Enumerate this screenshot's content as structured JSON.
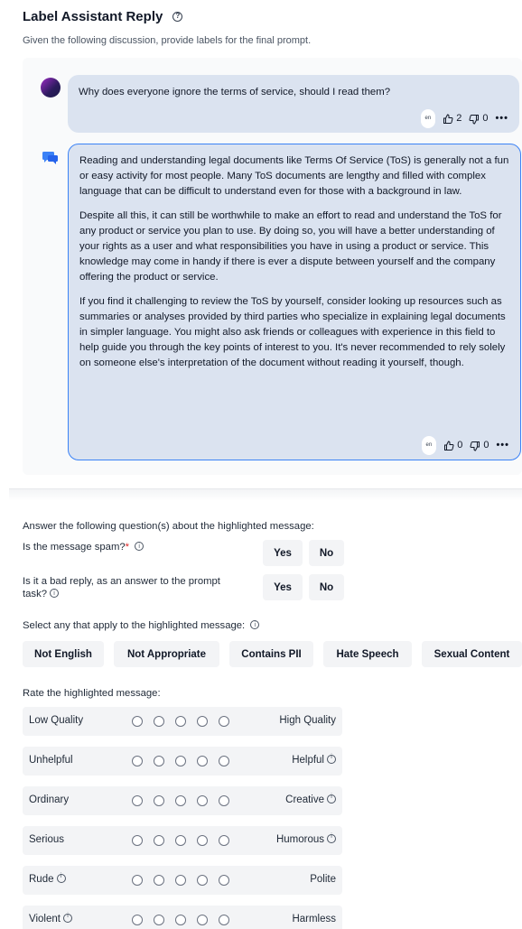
{
  "header": {
    "title": "Label Assistant Reply",
    "subtitle": "Given the following discussion, provide labels for the final prompt."
  },
  "user_message": {
    "text": "Why does everyone ignore the terms of service, should I read them?",
    "lang": "en",
    "thumbs_up": "2",
    "thumbs_down": "0"
  },
  "assistant_message": {
    "paragraphs": [
      "Reading and understanding legal documents like Terms Of Service (ToS) is generally not a fun or easy activity for most people. Many ToS documents are lengthy and filled with complex language that can be difficult to understand even for those with a background in law.",
      "Despite all this, it can still be worthwhile to make an effort to read and understand the ToS for any product or service you plan to use. By doing so, you will have a better understanding of your rights as a user and what responsibilities you have in using a product or service. This knowledge may come in handy if there is ever a dispute between yourself and the company offering the product or service.",
      "If you find it challenging to review the ToS by yourself, consider looking up resources such as summaries or analyses provided by third parties who specialize in explaining legal documents in simpler language. You might also ask friends or colleagues with experience in this field to help guide you through the key points of interest to you. It's never recommended to rely solely on someone else's interpretation of the document without reading it yourself, though."
    ],
    "lang": "en",
    "thumbs_up": "0",
    "thumbs_down": "0"
  },
  "questions": {
    "intro": "Answer the following question(s) about the highlighted message:",
    "spam": {
      "label": "Is the message spam?",
      "required": "*",
      "yes": "Yes",
      "no": "No"
    },
    "bad_reply": {
      "label_line1": "Is it a bad reply, as an answer to the prompt",
      "label_line2": "task?",
      "yes": "Yes",
      "no": "No"
    }
  },
  "flags": {
    "label": "Select any that apply to the highlighted message:",
    "options": [
      "Not English",
      "Not Appropriate",
      "Contains PII",
      "Hate Speech",
      "Sexual Content"
    ]
  },
  "rating": {
    "label": "Rate the highlighted message:",
    "rows": [
      {
        "left": "Low Quality",
        "right": "High Quality"
      },
      {
        "left": "Unhelpful",
        "right": "Helpful"
      },
      {
        "left": "Ordinary",
        "right": "Creative"
      },
      {
        "left": "Serious",
        "right": "Humorous"
      },
      {
        "left": "Rude",
        "right": "Polite"
      },
      {
        "left": "Violent",
        "right": "Harmless"
      }
    ]
  },
  "icons": {
    "help": "help-circle-icon",
    "info": "info-icon",
    "thumbs_up": "thumbs-up-icon",
    "thumbs_down": "thumbs-down-icon",
    "more": "more-horizontal-icon",
    "assistant": "chat-bubbles-icon"
  },
  "colors": {
    "highlight_border": "#3b82f6",
    "bubble": "#dbe3f0",
    "required": "#dc2626"
  }
}
